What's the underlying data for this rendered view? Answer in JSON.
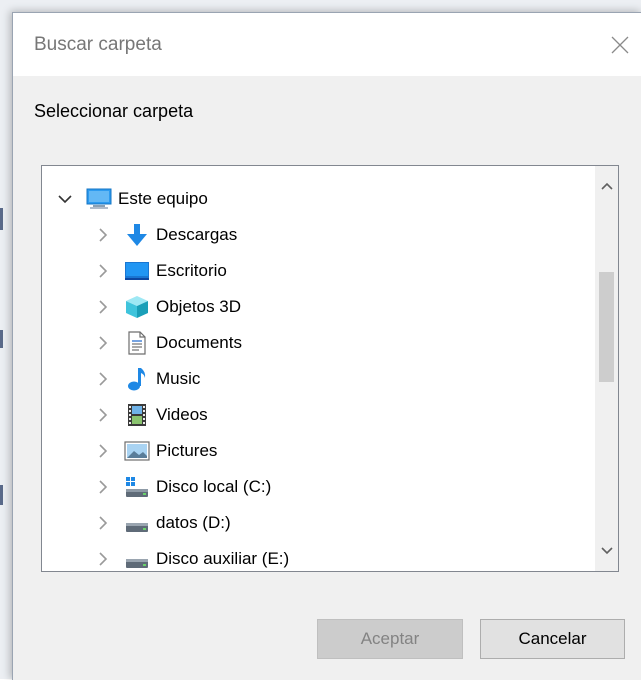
{
  "window": {
    "title": "Buscar carpeta"
  },
  "instruction": "Seleccionar carpeta",
  "tree": {
    "root": {
      "label": "Este equipo",
      "icon": "computer-icon",
      "expanded": true
    },
    "items": [
      {
        "label": "Descargas",
        "icon": "downloads-icon"
      },
      {
        "label": "Escritorio",
        "icon": "desktop-icon"
      },
      {
        "label": "Objetos 3D",
        "icon": "objects-3d-icon"
      },
      {
        "label": "Documents",
        "icon": "documents-icon"
      },
      {
        "label": "Music",
        "icon": "music-icon"
      },
      {
        "label": "Videos",
        "icon": "videos-icon"
      },
      {
        "label": "Pictures",
        "icon": "pictures-icon"
      },
      {
        "label": "Disco local (C:)",
        "icon": "system-drive-icon"
      },
      {
        "label": "datos (D:)",
        "icon": "drive-icon"
      },
      {
        "label": "Disco auxiliar (E:)",
        "icon": "drive-icon"
      }
    ]
  },
  "buttons": {
    "ok_label": "Aceptar",
    "ok_enabled": false,
    "cancel_label": "Cancelar"
  },
  "colors": {
    "dialog_bg": "#f0f0f0",
    "accent_blue": "#1e88e5",
    "disabled_text": "#838383"
  }
}
